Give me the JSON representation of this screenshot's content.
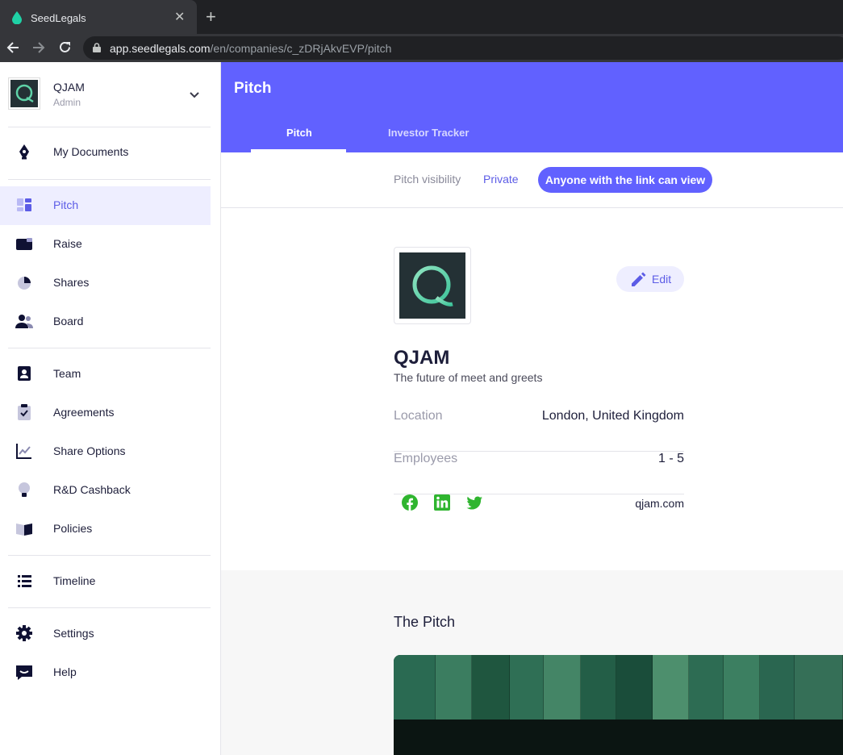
{
  "browser": {
    "tab_title": "SeedLegals",
    "url_host": "app.seedlegals.com",
    "url_path": "/en/companies/c_zDRjAkvEVP/pitch"
  },
  "sidebar": {
    "company_name": "QJAM",
    "company_role": "Admin",
    "items": [
      {
        "label": "My Documents",
        "icon": "pen-nib-icon"
      },
      {
        "label": "Pitch",
        "icon": "pitch-icon",
        "active": true
      },
      {
        "label": "Raise",
        "icon": "wallet-icon"
      },
      {
        "label": "Shares",
        "icon": "pie-chart-icon"
      },
      {
        "label": "Board",
        "icon": "people-icon"
      },
      {
        "label": "Team",
        "icon": "contact-card-icon"
      },
      {
        "label": "Agreements",
        "icon": "clipboard-check-icon"
      },
      {
        "label": "Share Options",
        "icon": "line-chart-icon"
      },
      {
        "label": "R&D Cashback",
        "icon": "lightbulb-icon"
      },
      {
        "label": "Policies",
        "icon": "book-icon"
      },
      {
        "label": "Timeline",
        "icon": "list-icon"
      },
      {
        "label": "Settings",
        "icon": "gear-icon"
      },
      {
        "label": "Help",
        "icon": "chat-icon"
      }
    ]
  },
  "header": {
    "title": "Pitch",
    "tabs": [
      {
        "label": "Pitch",
        "active": true
      },
      {
        "label": "Investor Tracker"
      }
    ]
  },
  "visibility": {
    "label": "Pitch visibility",
    "private_option": "Private",
    "link_option": "Anyone with the link can view"
  },
  "profile": {
    "edit_label": "Edit",
    "name": "QJAM",
    "tagline": "The future of meet and greets",
    "location_label": "Location",
    "location_value": "London, United Kingdom",
    "employees_label": "Employees",
    "employees_value": "1 - 5",
    "website": "qjam.com",
    "social_icons": [
      "facebook-icon",
      "linkedin-icon",
      "twitter-icon"
    ]
  },
  "pitch": {
    "title": "The Pitch"
  },
  "colors": {
    "brand": "#6161ff",
    "social_green": "#2fb52f"
  }
}
